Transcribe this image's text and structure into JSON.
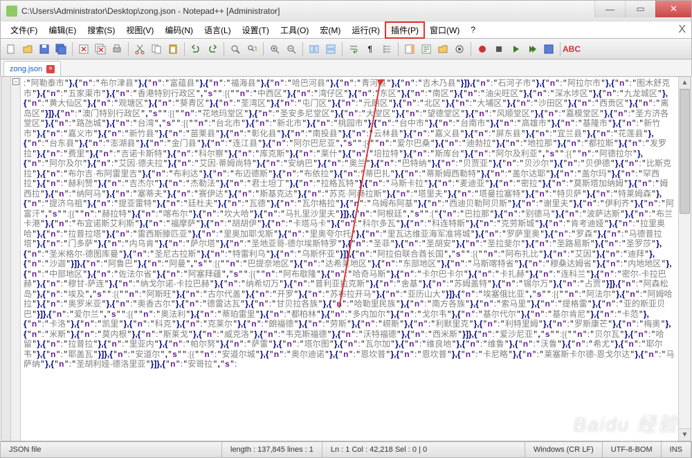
{
  "title": "C:\\Users\\Administrator\\Desktop\\zong.json - Notepad++ [Administrator]",
  "menus": [
    "文件(F)",
    "编辑(E)",
    "搜索(S)",
    "视图(V)",
    "编码(N)",
    "语言(L)",
    "设置(T)",
    "工具(O)",
    "宏(M)",
    "运行(R)",
    "插件(P)",
    "窗口(W)",
    "?"
  ],
  "highlighted_menu_index": 10,
  "tab": {
    "name": "zong.json",
    "close": "×"
  },
  "status": {
    "type": "JSON file",
    "length": "length : 137,845    lines : 1",
    "pos": "Ln : 1    Col : 42,218    Sel : 0 | 0",
    "eol": "Windows (CR LF)",
    "enc": "UTF-8-BOM",
    "mode": "INS"
  },
  "win_buttons": {
    "min": "—",
    "max": "▭",
    "close": "✕"
  },
  "json_tokens": [
    ":",
    "阿勒泰市",
    "},{",
    "n",
    ":",
    "布尔津县",
    "},{",
    "n",
    ":",
    "富蕴县",
    "},{",
    "n",
    ":",
    "福海县",
    "},{",
    "n",
    ":",
    "哈巴河县",
    "},{",
    "n",
    ":",
    "青河县",
    "},{",
    "n",
    ":",
    "吉木乃县",
    "}]},{",
    "n",
    ":",
    "石河子市",
    "},{",
    "n",
    ":",
    "阿拉尔市",
    "},{",
    "n",
    ":",
    "图木舒克市",
    "},{",
    "n",
    ":",
    "五家渠市",
    "},{",
    "n",
    ":",
    "香港特别行政区",
    ",",
    "s",
    ":[{",
    "n",
    ":",
    "中西区",
    "},{",
    "n",
    ":",
    "湾仔区",
    "},{",
    "n",
    ":",
    "东区",
    "},{",
    "n",
    ":",
    "南区",
    "},{",
    "n",
    ":",
    "油尖旺区",
    "},{",
    "n",
    ":",
    "深水埗区",
    "},{",
    "n",
    ":",
    "九龙城区",
    "},{",
    "n",
    ":",
    "黄大仙区",
    "},{",
    "n",
    ":",
    "观塘区",
    "},{",
    "n",
    ":",
    "葵青区",
    "},{",
    "n",
    ":",
    "荃湾区",
    "},{",
    "n",
    ":",
    "屯门区",
    "},{",
    "n",
    ":",
    "元朗区",
    "},{",
    "n",
    ":",
    "北区",
    "},{",
    "n",
    ":",
    "大埔区",
    "},{",
    "n",
    ":",
    "沙田区",
    "},{",
    "n",
    ":",
    "西贡区",
    "},{",
    "n",
    ":",
    "离岛区",
    "}]},{",
    "n",
    ":",
    "澳门特别行政区",
    ",",
    "s",
    ":[{",
    "n",
    ":",
    "花地玛堂区",
    "},{",
    "n",
    ":",
    "圣安多尼堂区",
    "},{",
    "n",
    ":",
    "大堂区",
    "},{",
    "n",
    ":",
    "望德堂区",
    "},{",
    "n",
    ":",
    "风顺堂区",
    "},{",
    "n",
    ":",
    "嘉模堂区",
    "},{",
    "n",
    ":",
    "圣方济各堂区",
    "},{",
    "n",
    ":",
    "路氹城",
    "},{",
    "n",
    ":",
    "台湾",
    ",",
    "s",
    ":[{",
    "n",
    ":",
    "台北市",
    "},{",
    "n",
    ":",
    "新北市",
    "},{",
    "n",
    ":",
    "桃园市",
    "},{",
    "n",
    ":",
    "台中市",
    "},{",
    "n",
    ":",
    "台南市",
    "},{",
    "n",
    ":",
    "高雄市",
    "},{",
    "n",
    ":",
    "基隆市",
    "},{",
    "n",
    ":",
    "新竹市",
    "},{",
    "n",
    ":",
    "嘉义市",
    "},{",
    "n",
    ":",
    "新竹县",
    "},{",
    "n",
    ":",
    "苗栗县",
    "},{",
    "n",
    ":",
    "彰化县",
    "},{",
    "n",
    ":",
    "南投县",
    "},{",
    "n",
    ":",
    "云林县",
    "},{",
    "n",
    ":",
    "嘉义县",
    "},{",
    "n",
    ":",
    "屏东县",
    "},{",
    "n",
    ":",
    "宜兰县",
    "},{",
    "n",
    ":",
    "花莲县",
    "},{",
    "n",
    ":",
    "台东县",
    "},{",
    "n",
    ":",
    "澎湖县",
    "},{",
    "n",
    ":",
    "金门县",
    "},{",
    "n",
    ":",
    "连江县",
    "},{",
    "n",
    ":",
    "阿尔巴尼亚",
    ",",
    "s",
    ":[{",
    "n",
    ":",
    "爱尔巴桑",
    "},{",
    "n",
    ":",
    "迪勃拉",
    "},{",
    "n",
    ":",
    "地拉那",
    "},{",
    "n",
    ":",
    "都拉斯",
    "},{",
    "n",
    ":",
    "发罗拉",
    "},{",
    "n",
    ":",
    "费里",
    "},{",
    "n",
    ":",
    "吉诺卡斯特",
    "},{",
    "n",
    ":",
    "科尔察",
    "},{",
    "n",
    ":",
    "库克斯",
    "},{",
    "n",
    ":",
    "莱什",
    "},",
    "{",
    "n",
    ":",
    "培拉特",
    "},{",
    "n",
    ":",
    "斯库台",
    "},{",
    "n",
    ":",
    "阿尔及利亚",
    ",",
    "s",
    ":[{",
    "n",
    ":",
    "阿德拉尔",
    "},{",
    "n",
    ":",
    "阿尔及尔",
    "},{",
    "n",
    ":",
    "艾因·德夫拉",
    "},{",
    "n",
    ":",
    "艾因·蒂姆尚特",
    "},{",
    "n",
    ":",
    "安纳巴",
    "},{",
    "n",
    ":",
    "奥兰",
    "},{",
    "n",
    ":",
    "巴特纳",
    "},{",
    "n",
    ":",
    "贝贾亚",
    "},{",
    "n",
    ":",
    "贝沙尔",
    "},{",
    "n",
    ":",
    "贝伊德",
    "},{",
    "n",
    ":",
    "比斯克拉",
    "},",
    "{",
    "n",
    ":",
    "布尔吉·布阿雷里吉",
    "},{",
    "n",
    ":",
    "布利达",
    "},{",
    "n",
    ":",
    "布迈德斯",
    "},{",
    "n",
    ":",
    "布依拉",
    "},{",
    "n",
    ":",
    "蒂巴扎",
    "},{",
    "n",
    ":",
    "蒂斯姆西勒特",
    "},{",
    "n",
    ":",
    "盖尔达耶",
    "},{",
    "n",
    ":",
    "盖尔玛",
    "},{",
    "n",
    ":",
    "罕西拉",
    "},{",
    "n",
    ":",
    "赫利赞",
    "},{",
    "n",
    ":",
    "吉杰尔",
    "},{",
    "n",
    ":",
    "杰勒法",
    "},{",
    "n",
    ":",
    "君士坦丁",
    "},{",
    "n",
    ":",
    "拉格瓦特",
    "},{",
    "n",
    ":",
    "马斯卡拉",
    "},{",
    "n",
    ":",
    "麦迪亚",
    "},{",
    "n",
    ":",
    "密拉",
    "},{",
    "n",
    ":",
    "莫斯塔加纳姆",
    "},{",
    "n",
    ":",
    "姆西拉",
    "},{",
    "n",
    ":",
    "纳阿马",
    "},{",
    "n",
    ":",
    "塞蒂夫",
    "},{",
    "n",
    ":",
    "赛伊达",
    "},{",
    "n",
    ":",
    "斯基克达",
    "},{",
    "n",
    ":",
    "苏克·阿赫拉斯",
    "},{",
    "n",
    ":",
    "塔里夫",
    "},{",
    "n",
    ":",
    "塔曼拉塞特",
    "},{",
    "n",
    ":",
    "特贝萨",
    "},{",
    "n",
    ":",
    "特莱姆森",
    "},{",
    "n",
    ":",
    "提济乌祖",
    "},{",
    "n",
    ":",
    "提亚雷特",
    "},{",
    "n",
    ":",
    "廷杜夫",
    "},{",
    "n",
    ":",
    "瓦德",
    "},{",
    "n",
    ":",
    "瓦尔格拉",
    "},{",
    "n",
    ":",
    "乌姆布阿基",
    "},{",
    "n",
    ":",
    "西迪贝勒阿贝斯",
    "},{",
    "n",
    ":",
    "谢里夫",
    "},{",
    "n",
    ":",
    "伊利齐",
    "},{",
    "n",
    ":",
    "阿富汗",
    ",",
    "s",
    ":[{",
    "n",
    ":",
    "赫拉特",
    "},{",
    "n",
    ":",
    "喀布尔",
    "},{",
    "n",
    ":",
    "坎大哈",
    "},{",
    "n",
    ":",
    "马扎里沙里夫",
    "}]},{",
    "n",
    ":",
    "阿根廷",
    ",",
    "s",
    ":[",
    "{",
    "n",
    ":",
    "巴拉那",
    "},{",
    "n",
    ":",
    "别德马",
    "},{",
    "n",
    ":",
    "波萨达斯",
    "},{",
    "n",
    ":",
    "布兰卡港",
    "},{",
    "n",
    ":",
    "布宜诺斯艾利斯",
    "},{",
    "n",
    ":",
    "福摩萨",
    "},{",
    "n",
    ":",
    "胡胡伊",
    "},{",
    "n",
    ":",
    "卡塔马卡",
    "},{",
    "n",
    ":",
    "科尔多瓦",
    "},{",
    "n",
    ":",
    "科连特斯",
    "},{",
    "n",
    ":",
    "克劳斯城",
    "},{",
    "n",
    ":",
    "肯考迪娅",
    "},{",
    "n",
    ":",
    "拉里奥哈",
    "},{",
    "n",
    ":",
    "拉普拉塔",
    "},{",
    "n",
    ":",
    "雷西斯滕匹亚",
    "},{",
    "n",
    ":",
    "里奥加耶戈斯",
    "},{",
    "n",
    ":",
    "里奥夸尔托",
    "},{",
    "n",
    ":",
    "里瓦达维亚海军准将城",
    "},{",
    "n",
    ":",
    "罗萨里奥",
    "},{",
    "n",
    ":",
    "罗森",
    "},",
    "{",
    "n",
    ":",
    "马德普拉塔",
    "},{",
    "n",
    ":",
    "门多萨",
    "},{",
    "n",
    ":",
    "内乌肯",
    "},{",
    "n",
    ":",
    "萨尔塔",
    "},{",
    "n",
    ":",
    "圣地亚哥-德尔埃斯特罗",
    "},{",
    "n",
    ":",
    "圣菲",
    "},{",
    "n",
    ":",
    "圣胡安",
    "},",
    "{",
    "n",
    ":",
    "圣拉斐尔",
    "},{",
    "n",
    ":",
    "圣路易斯",
    "},{",
    "n",
    ":",
    "圣罗莎",
    "},{",
    "n",
    ":",
    "圣米格尔-德图库曼",
    "},{",
    "n",
    ":",
    "圣尼古拉斯",
    "},{",
    "n",
    ":",
    "特雷利乌",
    "},{",
    "n",
    ":",
    "乌斯怀亚",
    "}]},{",
    "n",
    ":",
    "阿拉伯联合酋长国",
    ",",
    "s",
    ":[{",
    "n",
    ":",
    "阿布扎比",
    "},{",
    "n",
    ":",
    "艾因",
    "},{",
    "n",
    ":",
    "迪拜",
    "},{",
    "n",
    ":",
    "沙迦",
    "}]},{",
    "n",
    ":",
    "阿鲁巴",
    "},{",
    "n",
    ":",
    "阿曼",
    ",",
    "s",
    ":[{",
    "n",
    ":",
    "巴提奈地区",
    "},{",
    "n",
    ":",
    "达希莱地区",
    "},{",
    "n",
    ":",
    "东部地区",
    "},{",
    "n",
    ":",
    "马斯喀特省",
    "},{",
    "n",
    ":",
    "穆桑达姆省",
    "},{",
    "n",
    ":",
    "内地地区",
    "},{",
    "n",
    ":",
    "中部地区",
    "},{",
    "n",
    ":",
    "佐法尔省",
    "},{",
    "n",
    ":",
    "阿塞拜疆",
    ",",
    "s",
    ":[{",
    "n",
    ":",
    "阿布歇隆",
    "},{",
    "n",
    ":",
    "哈奇马斯",
    "},{",
    "n",
    ":",
    "卡尔巴卡尔",
    "},{",
    "n",
    ":",
    "卡扎赫",
    "},{",
    "n",
    ":",
    "连科兰",
    "},{",
    "n",
    ":",
    "密尔-卡拉巴赫",
    "},{",
    "n",
    ":",
    "穆甘-萨连",
    "},{",
    "n",
    ":",
    "纳戈尔诺-卡拉巴赫",
    "},{",
    "n",
    ":",
    "纳希切万",
    "},{",
    "n",
    ":",
    "普利亚拉克斯",
    "},{",
    "n",
    ":",
    "舍基",
    "},{",
    "n",
    ":",
    "苏姆盖特",
    "},{",
    "n",
    ":",
    "锡尔万",
    "},{",
    "n",
    ":",
    "占贾",
    "}]},{",
    "n",
    ":",
    "阿森松岛",
    "},{",
    "n",
    ":",
    "埃及",
    ",",
    "s",
    ":[{",
    "n",
    ":",
    "阿斯旺",
    "},{",
    "n",
    ":",
    "古尔代盖",
    "},{",
    "n",
    ":",
    "开罗",
    "},{",
    "n",
    ":",
    "苏布拉开马",
    "},{",
    "n",
    ":",
    "亚历山大",
    "}]},{",
    "n",
    ":",
    "埃塞俄比亚",
    ",",
    "s",
    ":[{",
    "n",
    ":",
    "阿法尔",
    "},{",
    "n",
    ":",
    "阿姆哈拉",
    "},{",
    "n",
    ":",
    "奥罗米亚",
    "},{",
    "n",
    ":",
    "奥香古尔",
    "},{",
    "n",
    ":",
    "德雷达瓦",
    "},{",
    "n",
    ":",
    "甘贝拉各族",
    "},{",
    "n",
    ":",
    "哈勒里民族",
    "},{",
    "n",
    ":",
    "南方各族",
    "},{",
    "n",
    ":",
    "索马里",
    "},{",
    "n",
    ":",
    "提格雷",
    "},",
    "{",
    "n",
    ":",
    "亚的斯亚贝巴",
    "}]},{",
    "n",
    ":",
    "爱尔兰",
    ",",
    "s",
    ":[{",
    "n",
    ":",
    "奥法利",
    "},{",
    "n",
    ":",
    "蒂珀雷里",
    "},{",
    "n",
    ":",
    "都柏林",
    "},{",
    "n",
    ":",
    "多内加尔",
    "},{",
    "n",
    ":",
    "戈尔韦",
    "},",
    "{",
    "n",
    ":",
    "基尔代尔",
    "},{",
    "n",
    ":",
    "基尔肯尼",
    "},{",
    "n",
    ":",
    "卡范",
    "},{",
    "n",
    ":",
    "卡洛",
    "},{",
    "n",
    ":",
    "凯里",
    "},{",
    "n",
    ":",
    "科克",
    "},{",
    "n",
    ":",
    "克莱尔",
    "},{",
    "n",
    ":",
    "朗福德",
    "},{",
    "n",
    ":",
    "劳斯",
    "},{",
    "n",
    ":",
    "崂斯",
    "},{",
    "n",
    ":",
    "利默里克",
    "},{",
    "n",
    ":",
    "利特里姆",
    "},{",
    "n",
    ":",
    "罗斯康芒",
    "},{",
    "n",
    ":",
    "梅奥",
    "},{",
    "n",
    ":",
    "米斯",
    "},{",
    "n",
    ":",
    "莫内根",
    "},{",
    "n",
    ":",
    "斯莱戈",
    "},{",
    "n",
    ":",
    "威克洛",
    "},{",
    "n",
    ":",
    "韦克斯福德",
    "},{",
    "n",
    ":",
    "沃特福德",
    "},{",
    "n",
    ":",
    "西米斯",
    "}]},{",
    "n",
    ":",
    "爱沙尼亚",
    ",",
    "s",
    ":[{",
    "n",
    ":",
    "贝尔瓦",
    "},{",
    "n",
    ":",
    "哈留",
    "},",
    "{",
    "n",
    ":",
    "拉普拉",
    "},{",
    "n",
    ":",
    "里亚内",
    "},{",
    "n",
    ":",
    "帕尔努",
    "},{",
    "n",
    ":",
    "萨雷",
    "},{",
    "n",
    ":",
    "塔尔图",
    "},{",
    "n",
    ":",
    "瓦尔加",
    "},{",
    "n",
    ":",
    "维良地",
    "},{",
    "n",
    ":",
    "维鲁",
    "},{",
    "n",
    ":",
    "沃鲁",
    "},{",
    "n",
    ":",
    "希尤",
    "},{",
    "n",
    ":",
    "耶尔韦",
    "},{",
    "n",
    ":",
    "耶盖瓦",
    "}]},{",
    "n",
    ":",
    "安道尔",
    ",",
    "s",
    ":[{",
    "n",
    ":",
    "安道尔城",
    "},{",
    "n",
    ":",
    "奥尔迪诺",
    "},{",
    "n",
    ":",
    "恩坎普",
    "},",
    "{",
    "n",
    ":",
    "恩坎普",
    "},{",
    "n",
    ":",
    "卡尼略",
    "},{",
    "n",
    ":",
    "莱塞斯卡尔德-恩戈尔达",
    "},{",
    "n",
    ":",
    "马萨纳",
    "},{",
    "n",
    ":",
    "圣胡利娅-德洛里亚",
    "}]},{",
    "n",
    ":",
    "安哥拉",
    ",",
    "s",
    ":"
  ],
  "watermark": {
    "main": "Baidu 经验",
    "sub": "jingyan.baidu.com"
  }
}
